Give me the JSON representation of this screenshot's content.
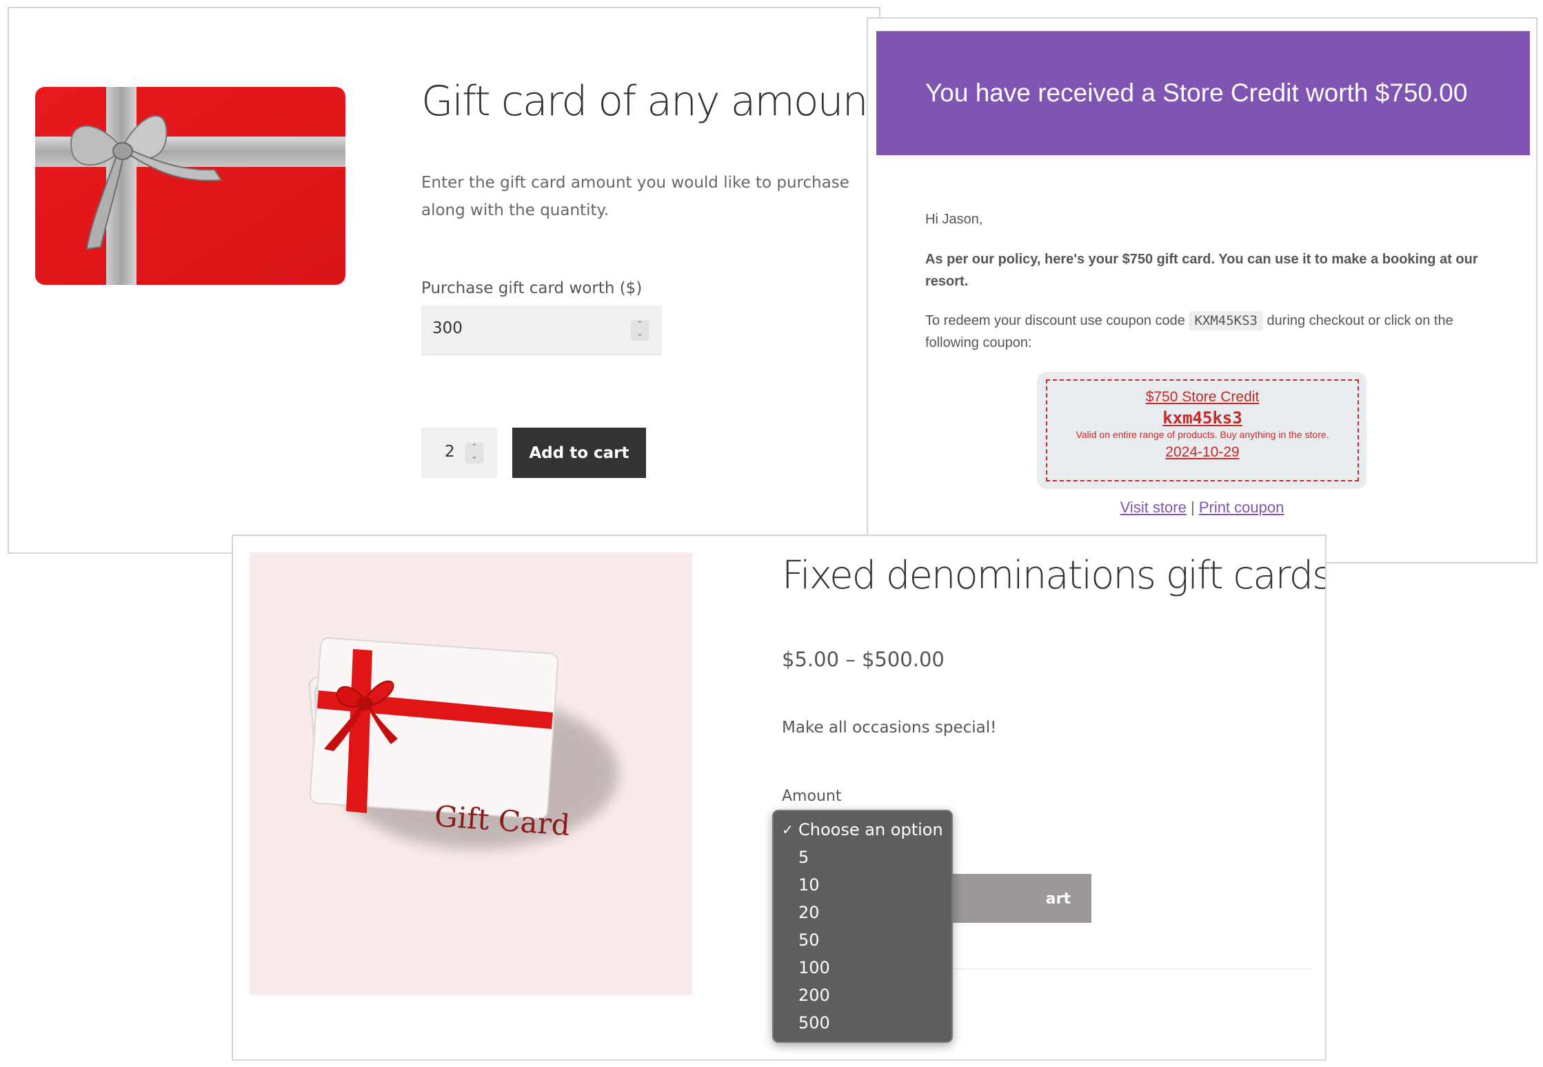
{
  "panel_any_amount": {
    "title": "Gift card of any amount",
    "description": "Enter the gift card amount you would like to purchase along with the quantity.",
    "amount_label": "Purchase gift card worth ($)",
    "amount_value": "300",
    "quantity_value": "2",
    "add_to_cart": "Add to cart"
  },
  "panel_email": {
    "banner": "You have received a Store Credit worth $750.00",
    "greeting": "Hi Jason,",
    "policy": "As per our policy, here's your $750 gift card. You can use it to make a booking at our resort.",
    "redeem_before": "To redeem your discount use coupon code",
    "coupon_code": "KXM45KS3",
    "redeem_after": "during checkout or click on the following coupon:",
    "coupon": {
      "title": "$750 Store Credit",
      "code": "kxm45ks3",
      "description": "Valid on entire range of products. Buy anything in the store.",
      "expiry": "2024-10-29"
    },
    "visit_store": "Visit store",
    "separator": "|",
    "print_coupon": "Print coupon",
    "accent_color": "#7f54b3",
    "coupon_color": "#c62828"
  },
  "panel_fixed": {
    "title": "Fixed denominations gift cards",
    "price_range": "$5.00 – $500.00",
    "description": "Make all occasions special!",
    "card_text": "Gift Card",
    "amount_label": "Amount",
    "add_to_cart_partial": "art",
    "dropdown": {
      "selected": "Choose an option",
      "options": [
        "5",
        "10",
        "20",
        "50",
        "100",
        "200",
        "500"
      ]
    }
  }
}
